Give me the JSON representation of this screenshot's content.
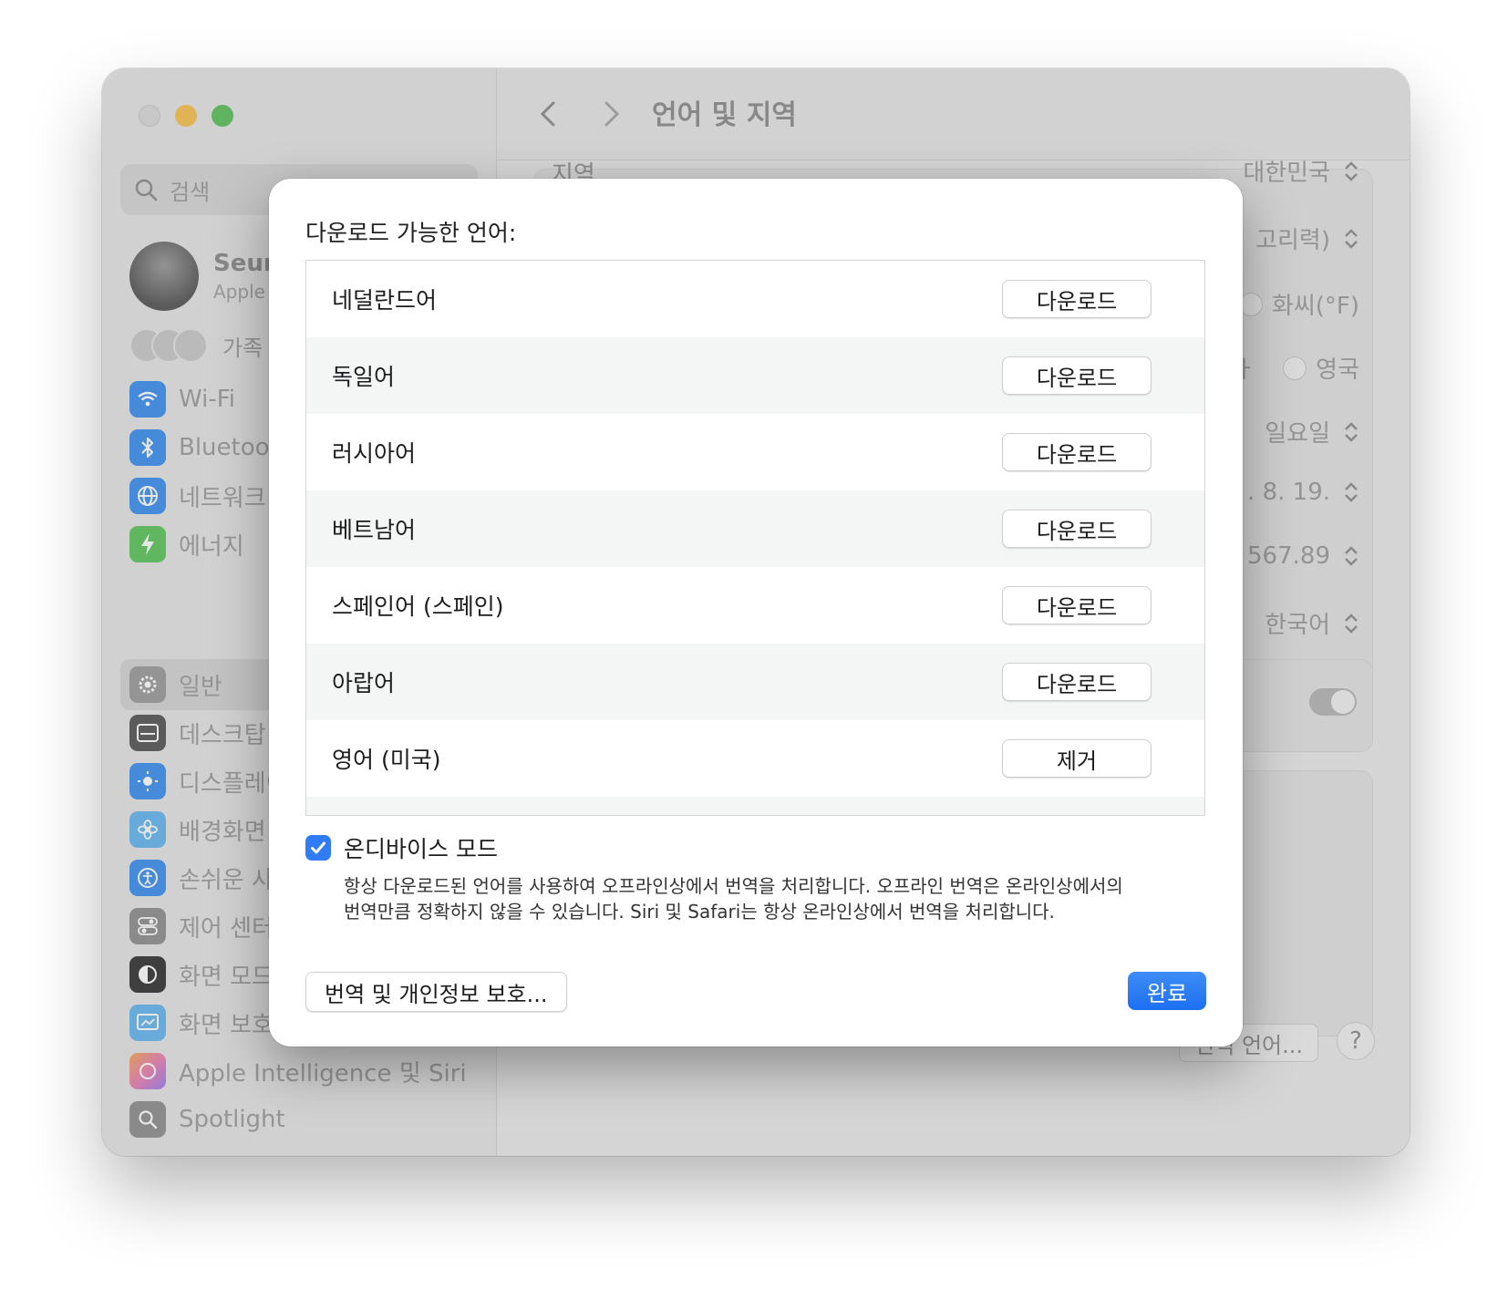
{
  "window": {
    "title": "언어 및 지역"
  },
  "sidebar": {
    "search_placeholder": "검색",
    "profile_name": "Seun",
    "profile_sub": "Apple",
    "family_label": "가족",
    "items": [
      {
        "label": "Wi-Fi",
        "icon": "wifi-icon",
        "color": "#3b8ef0"
      },
      {
        "label": "Bluetoot",
        "icon": "bluetooth-icon",
        "color": "#3b8ef0"
      },
      {
        "label": "네트워크",
        "icon": "globe-icon",
        "color": "#3b8ef0"
      },
      {
        "label": "에너지",
        "icon": "bolt-icon",
        "color": "#5cc55a"
      },
      {
        "label": "일반",
        "icon": "gear-icon",
        "color": "#9a9a9a"
      },
      {
        "label": "데스크탑",
        "icon": "desktop-icon",
        "color": "#555555"
      },
      {
        "label": "디스플레이",
        "icon": "sun-icon",
        "color": "#3b8ef0"
      },
      {
        "label": "배경화면",
        "icon": "flower-icon",
        "color": "#64b6f0"
      },
      {
        "label": "손쉬운 사",
        "icon": "accessibility-icon",
        "color": "#3b8ef0"
      },
      {
        "label": "제어 센터",
        "icon": "toggles-icon",
        "color": "#8e8e8e"
      },
      {
        "label": "화면 모드",
        "icon": "appearance-icon",
        "color": "#333333"
      },
      {
        "label": "화면 보호",
        "icon": "screensaver-icon",
        "color": "#64b6f0"
      },
      {
        "label": "Apple Intelligence 및 Siri",
        "icon": "siri-icon",
        "color": "#e87fb0"
      },
      {
        "label": "Spotlight",
        "icon": "search-icon",
        "color": "#8e8e8e"
      }
    ]
  },
  "background": {
    "region_label": "지역",
    "region_value": "대한민국",
    "calendar_value": "고리력)",
    "temp_value": "화씨(°F)",
    "measure_left": "ㅏ",
    "measure_value": "영국",
    "first_day_value": "일요일",
    "date_value": ". 8. 19.",
    "number_value": "567.89",
    "sort_value": "한국어",
    "translate_button": "번역 언어...",
    "help_button": "?"
  },
  "sheet": {
    "title": "다운로드 가능한 언어:",
    "languages": [
      {
        "name": "네덜란드어",
        "action": "다운로드"
      },
      {
        "name": "독일어",
        "action": "다운로드"
      },
      {
        "name": "러시아어",
        "action": "다운로드"
      },
      {
        "name": "베트남어",
        "action": "다운로드"
      },
      {
        "name": "스페인어 (스페인)",
        "action": "다운로드"
      },
      {
        "name": "아랍어",
        "action": "다운로드"
      },
      {
        "name": "영어 (미국)",
        "action": "제거"
      }
    ],
    "on_device_label": "온디바이스 모드",
    "on_device_checked": true,
    "description_line1": "항상 다운로드된 언어를 사용하여 오프라인상에서 번역을 처리합니다. 오프라인 번역은 온라인상에서의",
    "description_line2": "번역만큼 정확하지 않을 수 있습니다. Siri 및 Safari는 항상 온라인상에서 번역을 처리합니다.",
    "privacy_button": "번역 및 개인정보 보호...",
    "done_button": "완료",
    "accent_color": "#2f7cf6"
  }
}
